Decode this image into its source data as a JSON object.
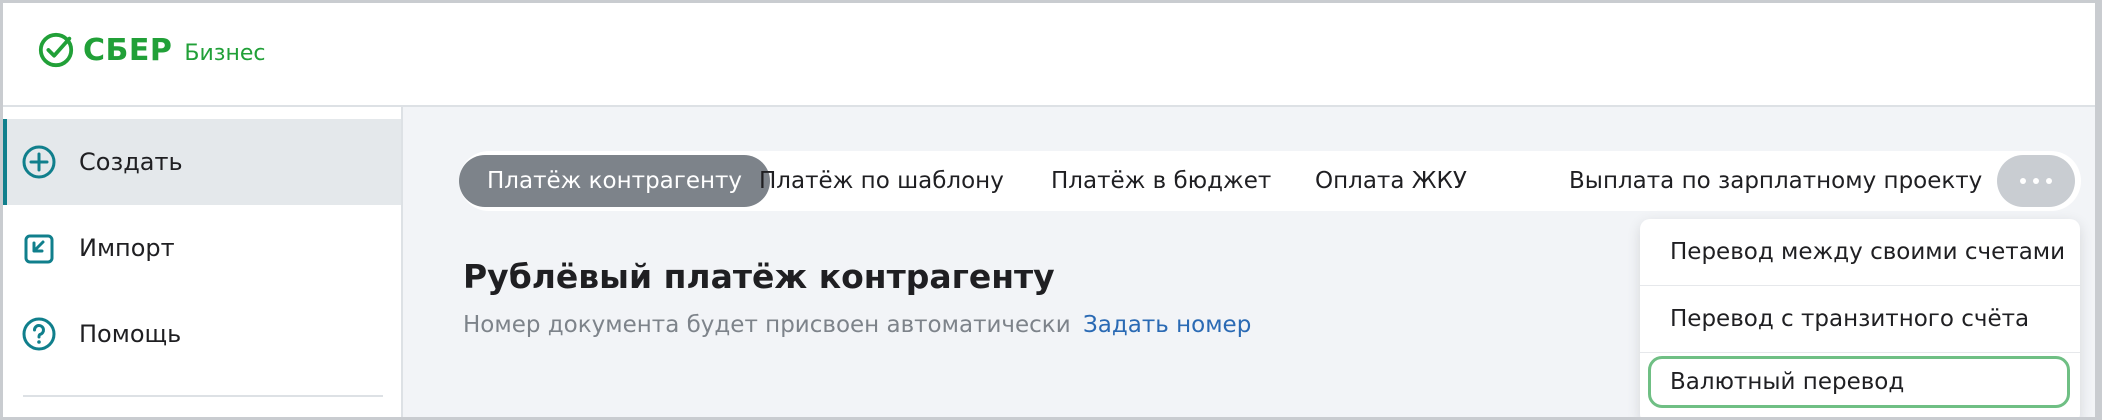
{
  "brand": {
    "name": "СБЕР",
    "subtitle": "Бизнес",
    "color": "#21a038"
  },
  "sidebar": {
    "items": [
      {
        "label": "Создать",
        "icon": "plus-circle-icon",
        "active": true
      },
      {
        "label": "Импорт",
        "icon": "import-icon",
        "active": false
      },
      {
        "label": "Помощь",
        "icon": "help-circle-icon",
        "active": false
      }
    ]
  },
  "tabs": [
    {
      "label": "Платёж контрагенту",
      "active": true
    },
    {
      "label": "Платёж по шаблону",
      "active": false
    },
    {
      "label": "Платёж в бюджет",
      "active": false
    },
    {
      "label": "Оплата ЖКУ",
      "active": false
    },
    {
      "label": "Выплата по зарплатному проекту",
      "active": false
    }
  ],
  "more_button": {
    "icon": "more-dots-icon"
  },
  "document": {
    "title": "Рублёвый платёж контрагенту",
    "number_note": "Номер документа будет присвоен автоматически",
    "set_number_link": "Задать номер"
  },
  "dropdown": {
    "items": [
      {
        "label": "Перевод между своими счетами"
      },
      {
        "label": "Перевод с транзитного счёта"
      },
      {
        "label": "Валютный перевод",
        "focused": true
      }
    ]
  },
  "colors": {
    "accent": "#107f8c",
    "active_tab": "#7d838a",
    "link": "#2a6ab4",
    "focus_ring": "#6fbf84"
  }
}
